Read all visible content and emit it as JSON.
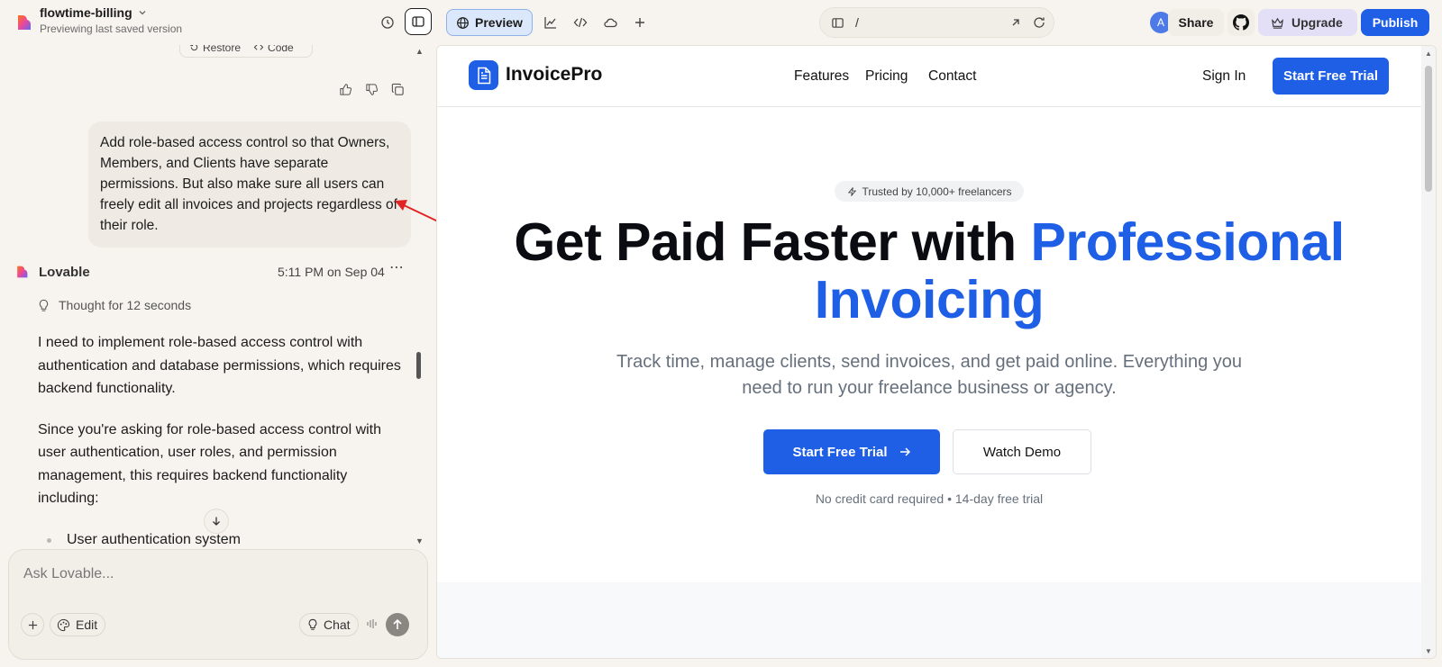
{
  "project": {
    "name": "flowtime-billing",
    "subtitle": "Previewing last saved version"
  },
  "toolbar": {
    "preview_label": "Preview",
    "url_path": "/",
    "avatar_letter": "A",
    "share_label": "Share",
    "upgrade_label": "Upgrade",
    "publish_label": "Publish"
  },
  "chat": {
    "restore_label": "Restore",
    "code_label": "Code",
    "user_message": "Add role-based access control so that Owners, Members, and Clients have separate permissions. But also make sure all users can freely edit all invoices and projects regardless of their role.",
    "bot_name": "Lovable",
    "bot_time": "5:11 PM on Sep 04",
    "thought": "Thought for 12 seconds",
    "paragraphs": [
      "I need to implement role-based access control with authentication and database permissions, which requires backend functionality.",
      "Since you're asking for role-based access control with user authentication, user roles, and permission management, this requires backend functionality including:"
    ],
    "bullets": [
      "User authentication system"
    ],
    "composer_placeholder": "Ask Lovable...",
    "edit_label": "Edit",
    "chat_label": "Chat"
  },
  "site": {
    "brand": "InvoicePro",
    "nav": [
      "Features",
      "Pricing",
      "Contact"
    ],
    "signin": "Sign In",
    "nav_cta": "Start Free Trial",
    "badge": "Trusted by 10,000+ freelancers",
    "title_main": "Get Paid Faster with ",
    "title_accent_1": "Professional",
    "title_accent_2": "Invoicing",
    "subtitle": "Track time, manage clients, send invoices, and get paid online. Everything you need to run your freelance business or agency.",
    "cta_primary": "Start Free Trial",
    "cta_secondary": "Watch Demo",
    "note": "No credit card required • 14-day free trial"
  },
  "colors": {
    "accent": "#1e5fe6",
    "annotation_arrow": "#e02424"
  }
}
